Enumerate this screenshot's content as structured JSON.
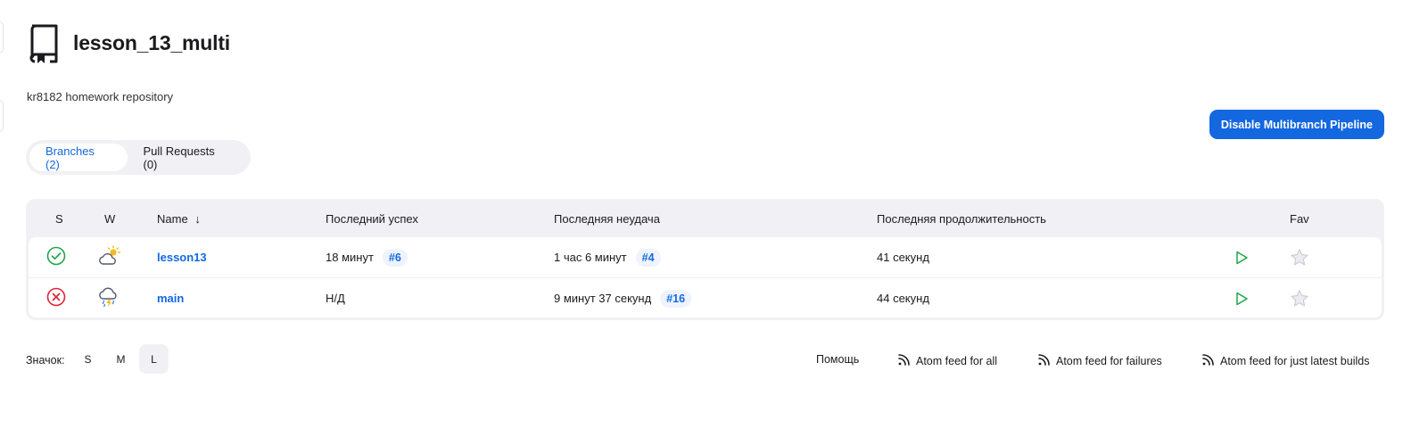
{
  "job": {
    "title": "lesson_13_multi",
    "description": "kr8182 homework repository"
  },
  "actions": {
    "disable_label": "Disable Multibranch Pipeline"
  },
  "tabs": [
    {
      "label": "Branches (2)",
      "active": true
    },
    {
      "label": "Pull Requests (0)",
      "active": false
    }
  ],
  "table": {
    "headers": {
      "s": "S",
      "w": "W",
      "name": "Name",
      "sort": "↓",
      "last_success": "Последний успех",
      "last_failure": "Последняя неудача",
      "last_duration": "Последняя продолжительность",
      "fav": "Fav"
    },
    "rows": [
      {
        "status": "success",
        "weather": "partly-cloudy",
        "name": "lesson13",
        "last_success": "18 минут",
        "last_success_build": "#6",
        "last_failure": "1 час 6 минут",
        "last_failure_build": "#4",
        "last_duration": "41 секунд"
      },
      {
        "status": "failed",
        "weather": "thunderstorm",
        "name": "main",
        "last_success": "Н/Д",
        "last_success_build": "",
        "last_failure": "9 минут 37 секунд",
        "last_failure_build": "#16",
        "last_duration": "44 секунд"
      }
    ]
  },
  "footer": {
    "icon_label": "Значок:",
    "sizes": [
      {
        "label": "S",
        "active": false
      },
      {
        "label": "M",
        "active": false
      },
      {
        "label": "L",
        "active": true
      }
    ],
    "help": "Помощь",
    "feeds": {
      "all": "Atom feed for all",
      "failures": "Atom feed for failures",
      "latest": "Atom feed for just latest builds"
    }
  },
  "colors": {
    "accent": "#1368e0",
    "success": "#1ea64b",
    "failure": "#e0233a"
  }
}
